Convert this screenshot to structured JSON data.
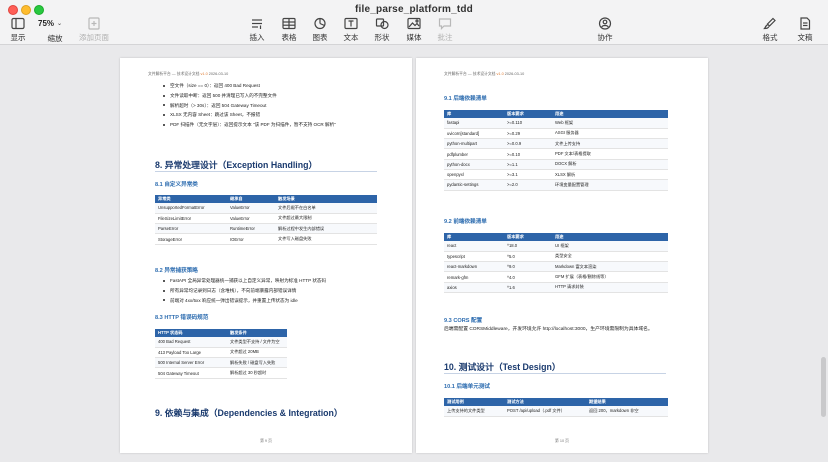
{
  "window": {
    "title": "file_parse_platform_tdd"
  },
  "toolbar": {
    "view": "显示",
    "zoom": {
      "value": "75%",
      "label": "缩放"
    },
    "add_page": "添加页面",
    "insert": "插入",
    "table": "表格",
    "chart": "图表",
    "text": "文本",
    "shape": "形状",
    "media": "媒体",
    "comment": "批注",
    "collaborate": "协作",
    "format": "格式",
    "document": "文稿"
  },
  "doc_header": {
    "title": "文件解析平台 — 技术设计文档",
    "version": "v1.0",
    "date": "2026-03-10"
  },
  "left_page": {
    "bullets_top": [
      "空文件（size == 0）：返回 400 Bad Request",
      "文件读取中断：返回 500 并清理已写入的不完整文件",
      "解析超时（> 30s）：返回 504 Gateway Timeout",
      "XLSX 无内容 Sheet：跳过该 Sheet，不报错",
      "PDF 扫描件（无文字层）：返回提示文本 \"该 PDF 为扫描件，暂不支持 OCR 解析\""
    ],
    "h1_exception": "8. 异常处理设计（Exception Handling）",
    "h2_custom": "8.1 自定义异常类",
    "exception_table": {
      "headers": [
        "异常类",
        "继承自",
        "触发场景"
      ],
      "rows": [
        [
          "UnsupportedFormatError",
          "ValueError",
          "文件后缀不在白名单"
        ],
        [
          "FileSizeLimitError",
          "ValueError",
          "文件超过最大限制"
        ],
        [
          "ParseError",
          "RuntimeError",
          "解析过程中发生内部错误"
        ],
        [
          "StorageError",
          "IOError",
          "文件写入磁盘失败"
        ]
      ]
    },
    "h2_catch": "8.2 异常捕获策略",
    "bullets_catch": [
      "FastAPI 全局异常处理器统一捕获以上自定义异常，映射为标准 HTTP 状态码",
      "所有异常均记录到日志（含堆栈），不向前端暴露内部错误详情",
      "前端对 4xx/5xx 响应统一弹出错误提示，并重置上传状态为 idle"
    ],
    "h2_http": "8.3 HTTP 错误码规范",
    "http_table": {
      "headers": [
        "HTTP 状态码",
        "触发条件"
      ],
      "rows": [
        [
          "400 Bad Request",
          "文件类型不支持 / 文件为空"
        ],
        [
          "413 Payload Too Large",
          "文件超过 20MB"
        ],
        [
          "500 Internal Server Error",
          "解析失败 / 磁盘写入失败"
        ],
        [
          "504 Gateway Timeout",
          "解析超过 30 秒超时"
        ]
      ]
    },
    "h1_deps": "9. 依赖与集成（Dependencies & Integration）",
    "footer": "第 9 页"
  },
  "right_page": {
    "h2_backend": "9.1 后端依赖清单",
    "backend_table": {
      "headers": [
        "库",
        "版本要求",
        "用途"
      ],
      "rows": [
        [
          "fastapi",
          ">=0.110",
          "Web 框架"
        ],
        [
          "uvicorn[standard]",
          ">=0.29",
          "ASGI 服务器"
        ],
        [
          "python-multipart",
          ">=0.0.9",
          "文件上传支持"
        ],
        [
          "pdfplumber",
          ">=0.10",
          "PDF 文本/表格提取"
        ],
        [
          "python-docx",
          ">=1.1",
          "DOCX 解析"
        ],
        [
          "openpyxl",
          ">=3.1",
          "XLSX 解析"
        ],
        [
          "pydantic-settings",
          ">=2.0",
          "环境变量配置管理"
        ]
      ]
    },
    "h2_frontend": "9.2 前端依赖清单",
    "frontend_table": {
      "headers": [
        "库",
        "版本要求",
        "用途"
      ],
      "rows": [
        [
          "react",
          "^18.0",
          "UI 框架"
        ],
        [
          "typescript",
          "^5.0",
          "类型安全"
        ],
        [
          "react-markdown",
          "^9.0",
          "Markdown 富文本渲染"
        ],
        [
          "remark-gfm",
          "^4.0",
          "GFM 扩展（表格/删除线等）"
        ],
        [
          "axios",
          "^1.6",
          "HTTP 请求封装"
        ]
      ]
    },
    "h2_cors": "9.3 CORS 配置",
    "cors_text": "后端需配置 CORSMiddleware，开发环境允许 http://localhost:3000，生产环境需限制为具体域名。",
    "h1_test": "10. 测试设计（Test Design）",
    "h2_unit": "10.1 后端单元测试",
    "test_table": {
      "headers": [
        "测试用例",
        "测试方法",
        "期望结果"
      ],
      "rows": [
        [
          "上传支持的文件类型",
          "POST /api/upload（.pdf 文件）",
          "返回 200，markdown 非空"
        ]
      ]
    },
    "footer": "第 10 页"
  },
  "colors": {
    "heading_dark": "#1a3a6e",
    "heading_blue": "#2e6db0",
    "table_header": "#2d64a8",
    "version_accent": "#e07a2f"
  }
}
